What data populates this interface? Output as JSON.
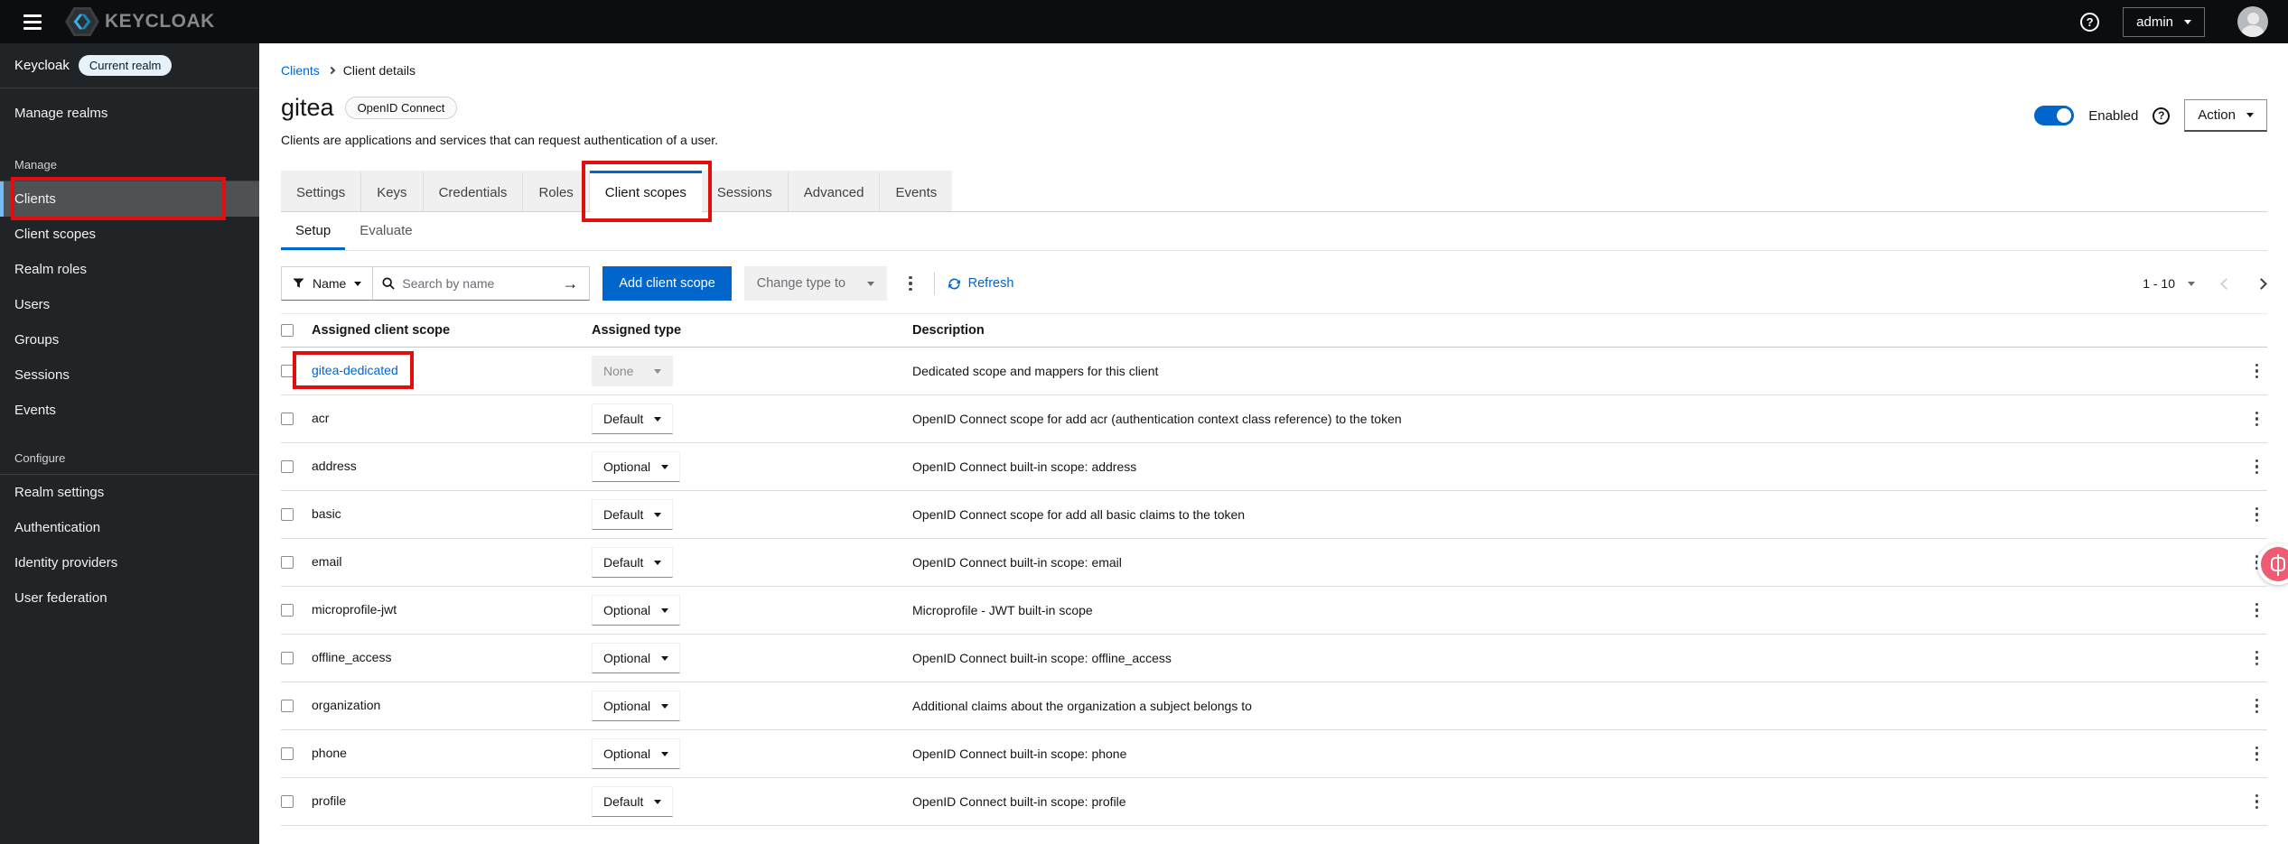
{
  "masthead": {
    "brand": "KEYCLOAK",
    "user_menu_label": "admin"
  },
  "sidebar": {
    "realm_name": "Keycloak",
    "realm_badge": "Current realm",
    "top_items": [
      {
        "label": "Manage realms"
      }
    ],
    "sections": [
      {
        "title": "Manage",
        "items": [
          {
            "label": "Clients",
            "active": true,
            "annotated": true
          },
          {
            "label": "Client scopes"
          },
          {
            "label": "Realm roles"
          },
          {
            "label": "Users"
          },
          {
            "label": "Groups"
          },
          {
            "label": "Sessions"
          },
          {
            "label": "Events"
          }
        ]
      },
      {
        "title": "Configure",
        "items": [
          {
            "label": "Realm settings"
          },
          {
            "label": "Authentication"
          },
          {
            "label": "Identity providers"
          },
          {
            "label": "User federation"
          }
        ]
      }
    ]
  },
  "breadcrumb": {
    "items": [
      "Clients",
      "Client details"
    ]
  },
  "header": {
    "title": "gitea",
    "protocol_badge": "OpenID Connect",
    "description": "Clients are applications and services that can request authentication of a user.",
    "enabled_label": "Enabled",
    "action_label": "Action"
  },
  "tabs": [
    {
      "label": "Settings"
    },
    {
      "label": "Keys"
    },
    {
      "label": "Credentials"
    },
    {
      "label": "Roles"
    },
    {
      "label": "Client scopes",
      "active": true,
      "annotated": true
    },
    {
      "label": "Sessions"
    },
    {
      "label": "Advanced"
    },
    {
      "label": "Events"
    }
  ],
  "subtabs": [
    {
      "label": "Setup",
      "active": true
    },
    {
      "label": "Evaluate"
    }
  ],
  "toolbar": {
    "filter_label": "Name",
    "search_placeholder": "Search by name",
    "add_button_label": "Add client scope",
    "change_type_label": "Change type to",
    "refresh_label": "Refresh",
    "pagination_range": "1 - 10"
  },
  "table": {
    "headers": [
      "Assigned client scope",
      "Assigned type",
      "Description"
    ],
    "rows": [
      {
        "name": "gitea-dedicated",
        "link": true,
        "annotated": true,
        "type": "None",
        "type_disabled": true,
        "description": "Dedicated scope and mappers for this client"
      },
      {
        "name": "acr",
        "type": "Default",
        "description": "OpenID Connect scope for add acr (authentication context class reference) to the token"
      },
      {
        "name": "address",
        "type": "Optional",
        "description": "OpenID Connect built-in scope: address"
      },
      {
        "name": "basic",
        "type": "Default",
        "description": "OpenID Connect scope for add all basic claims to the token"
      },
      {
        "name": "email",
        "type": "Default",
        "description": "OpenID Connect built-in scope: email"
      },
      {
        "name": "microprofile-jwt",
        "type": "Optional",
        "description": "Microprofile - JWT built-in scope"
      },
      {
        "name": "offline_access",
        "type": "Optional",
        "description": "OpenID Connect built-in scope: offline_access"
      },
      {
        "name": "organization",
        "type": "Optional",
        "description": "Additional claims about the organization a subject belongs to"
      },
      {
        "name": "phone",
        "type": "Optional",
        "description": "OpenID Connect built-in scope: phone"
      },
      {
        "name": "profile",
        "type": "Default",
        "description": "OpenID Connect built-in scope: profile"
      }
    ]
  },
  "colors": {
    "accent_blue": "#0066cc",
    "annotation_red": "#e40d0d",
    "masthead_bg": "#0b0d0f",
    "sidebar_bg": "#212427",
    "sidebar_selected_bg": "#4f5255",
    "sidebar_selected_strip": "#73bcf7",
    "logo_cyan": "#33b1e2",
    "floating_widget_pink": "#ee5b72",
    "disabled_bg": "#f0f0f0"
  }
}
